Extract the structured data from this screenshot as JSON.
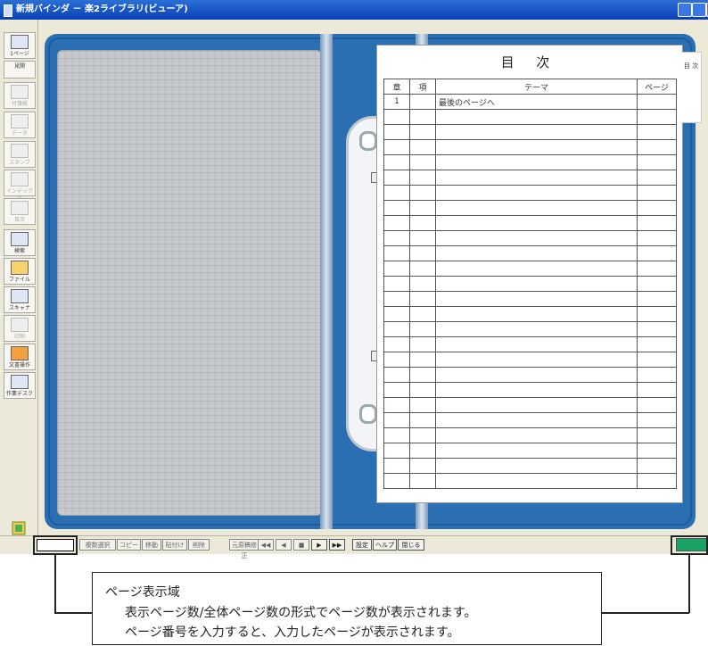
{
  "window": {
    "title": "新規バインダ － 楽2ライブラリ(ビューア)"
  },
  "toolbar": {
    "items": [
      {
        "label": "1ページ"
      },
      {
        "label": "見開"
      },
      {
        "label": "付箋紙"
      },
      {
        "label": "データ"
      },
      {
        "label": "スタンプ"
      },
      {
        "label": "インデックス"
      },
      {
        "label": "目次"
      },
      {
        "label": "検索"
      },
      {
        "label": "ファイル"
      },
      {
        "label": "スキャナ"
      },
      {
        "label": "印刷"
      },
      {
        "label": "文書操作"
      },
      {
        "label": "作業デスク"
      }
    ]
  },
  "toc": {
    "title": "目 次",
    "headers": [
      "章",
      "項",
      "テーマ",
      "ページ"
    ],
    "rows": [
      {
        "chapter": "1",
        "section": "",
        "theme": "最後のページへ",
        "page": ""
      }
    ],
    "side_tab": "目\n次"
  },
  "statusbar": {
    "page_value": "",
    "buttons": [
      "複数選択",
      "コピー",
      "移動",
      "貼付け",
      "削除",
      "元原稿修正",
      "◀◀",
      "◀",
      "■",
      "▶",
      "▶▶",
      "設定",
      "ヘルプ",
      "閉じる"
    ]
  },
  "callout": {
    "title": "ページ表示域",
    "line1": "表示ページ数/全体ページ数の形式でページ数が表示されます。",
    "line2": "ページ番号を入力すると、入力したページが表示されます。"
  },
  "colors": {
    "book_blue": "#2b6fb3",
    "status_green": "#1aa164",
    "title_blue": "#0a3fb5"
  }
}
